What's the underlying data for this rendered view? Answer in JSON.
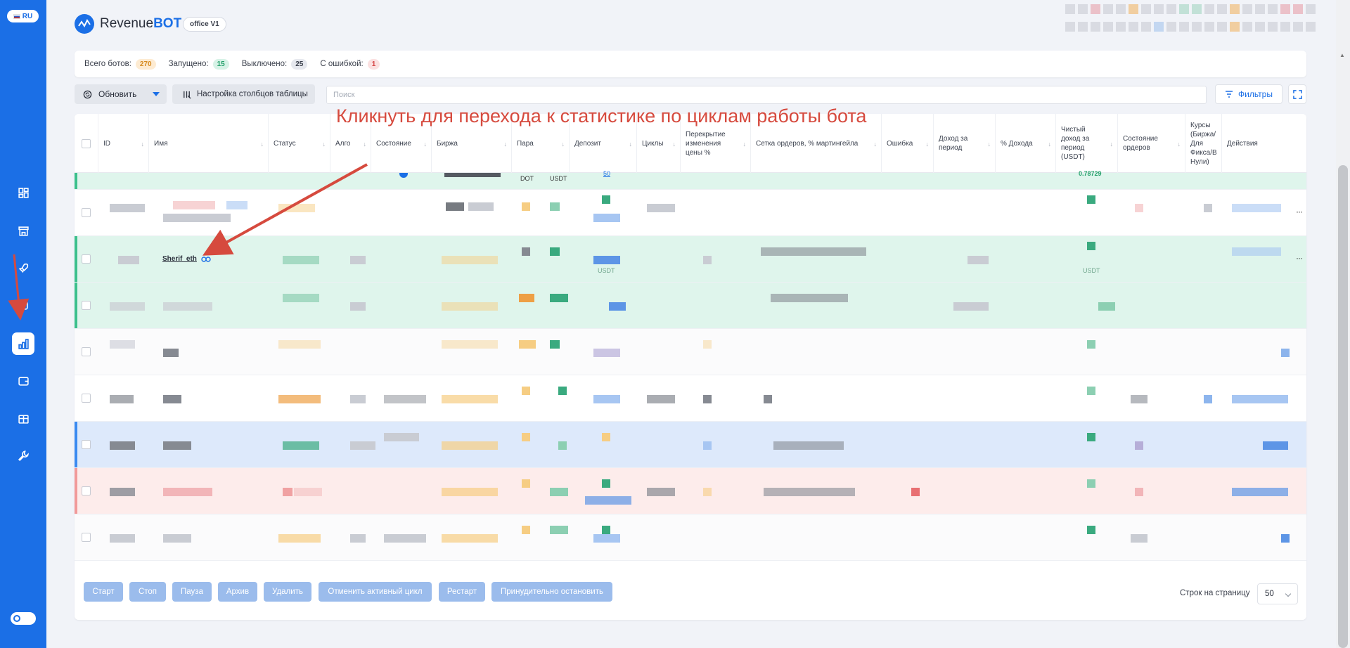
{
  "sidebar": {
    "lang": "RU",
    "items": [
      {
        "icon": "dashboard-icon"
      },
      {
        "icon": "store-icon"
      },
      {
        "icon": "rocket-icon"
      },
      {
        "icon": "box-icon"
      },
      {
        "icon": "statistics-icon",
        "active": true
      },
      {
        "icon": "wallet-icon"
      },
      {
        "icon": "gift-icon"
      },
      {
        "icon": "wrench-icon"
      }
    ]
  },
  "header": {
    "logo_text": "Revenue",
    "logo_accent": "BOT",
    "office_badge": "office V1"
  },
  "stats": {
    "total_label": "Всего ботов:",
    "total_value": "270",
    "running_label": "Запущено:",
    "running_value": "15",
    "off_label": "Выключено:",
    "off_value": "25",
    "error_label": "С ошибкой:",
    "error_value": "1"
  },
  "toolbar": {
    "refresh_label": "Обновить",
    "columns_label": "Настройка столбцов таблицы",
    "search_placeholder": "Поиск",
    "filters_label": "Фильтры"
  },
  "table": {
    "headers": {
      "id": "ID",
      "name": "Имя",
      "status": "Статус",
      "algo": "Алго",
      "state": "Состояние",
      "exchange": "Биржа",
      "pair": "Пара",
      "deposit": "Депозит",
      "cycles": "Циклы",
      "overlap": "Перекрытие изменения цены %",
      "grid": "Сетка ордеров, % мартингейла",
      "error": "Ошибка",
      "income": "Доход за период",
      "income_pct": "% Дохода",
      "net_income": "Чистый доход за период (USDT)",
      "orders_state": "Состояние ордеров",
      "rates": "Курсы (Биржа/Для Фикса/В Нули)",
      "actions": "Действия"
    },
    "partial_row": {
      "pair_base": "DOT",
      "pair_quote": "USDT",
      "deposit": "50",
      "net_income": "0.78729"
    },
    "highlighted_bot": {
      "name": "Sherif_eth",
      "deposit_currency": "USDT",
      "net_currency": "USDT"
    }
  },
  "footer": {
    "buttons": [
      "Старт",
      "Стоп",
      "Пауза",
      "Архив",
      "Удалить",
      "Отменить активный цикл",
      "Рестарт",
      "Принудительно остановить"
    ],
    "rows_per_page_label": "Строк на страницу",
    "rows_per_page_value": "50"
  },
  "annotation": {
    "text": "Кликнуть для перехода к статистике по циклам работы бота"
  },
  "colors": {
    "primary": "#1b6fe6",
    "annotation": "#d64a3e",
    "row_green": "#dff5ec",
    "row_blue": "#dde9fb",
    "row_pink": "#fdeceb"
  }
}
